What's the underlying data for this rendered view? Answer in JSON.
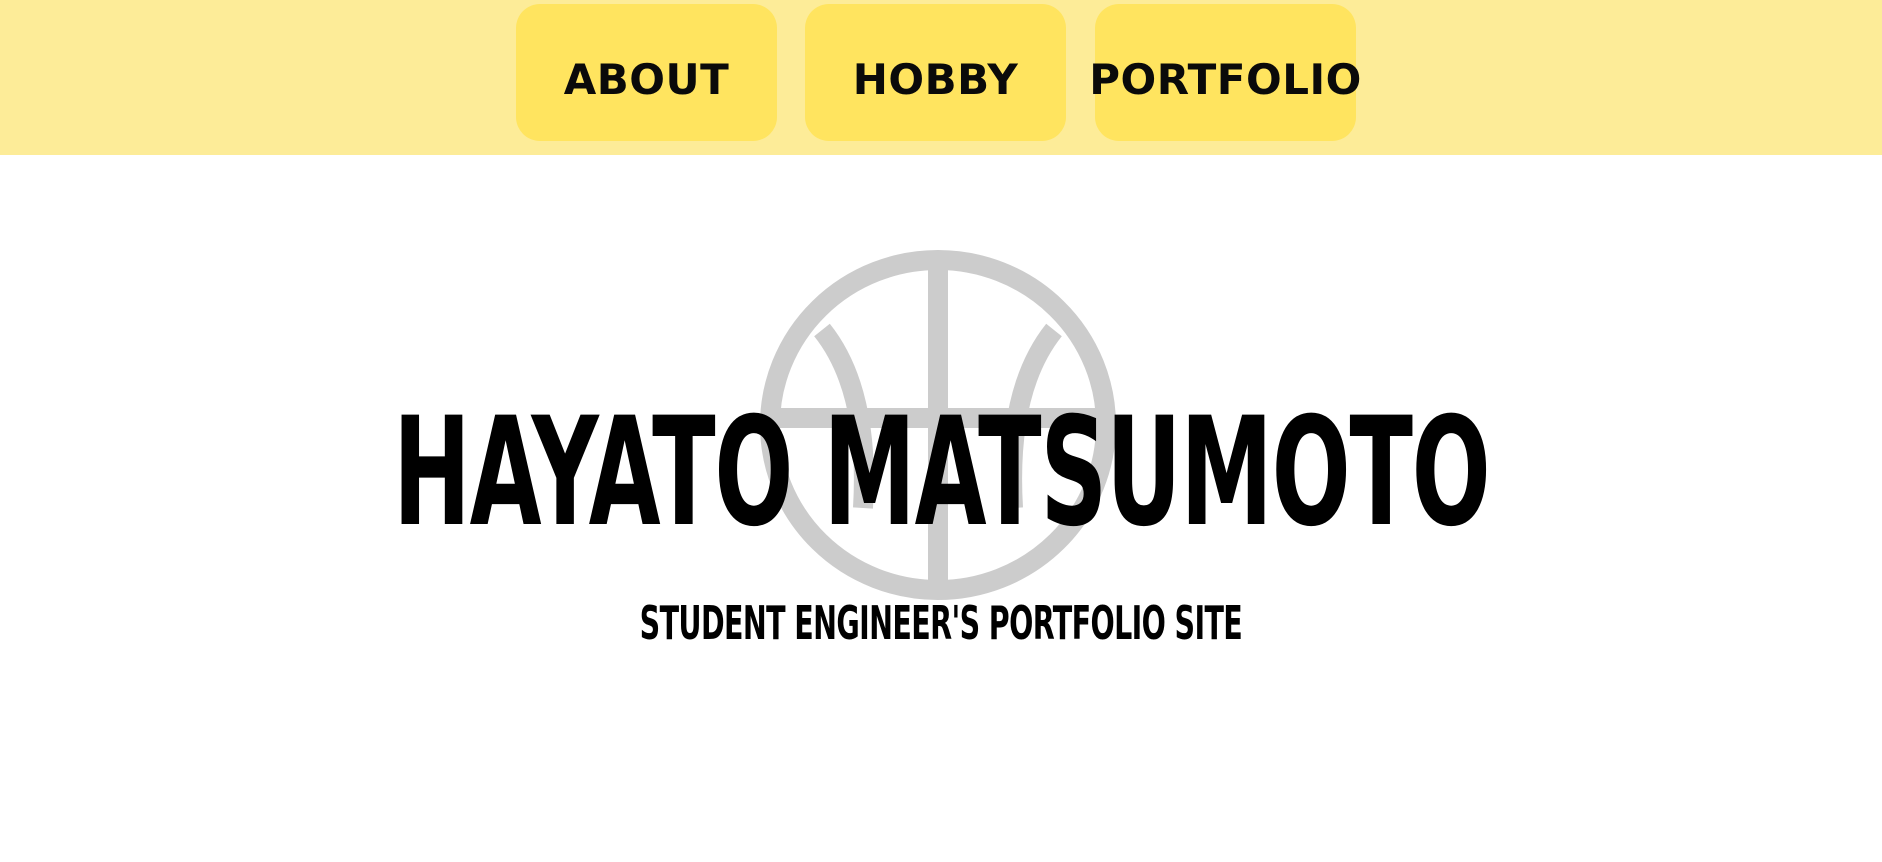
{
  "nav": {
    "items": [
      {
        "label": "ABOUT"
      },
      {
        "label": "HOBBY"
      },
      {
        "label": "PORTFOLIO"
      }
    ]
  },
  "hero": {
    "title": "HAYATO MATSUMOTO",
    "subtitle": "STUDENT ENGINEER'S PORTFOLIO SITE",
    "background_icon": "basketball-icon"
  },
  "colors": {
    "navbar_bg": "#fdec98",
    "nav_button_bg": "#ffe45f",
    "text": "#000000",
    "icon": "#cccccc",
    "page_bg": "#ffffff"
  }
}
